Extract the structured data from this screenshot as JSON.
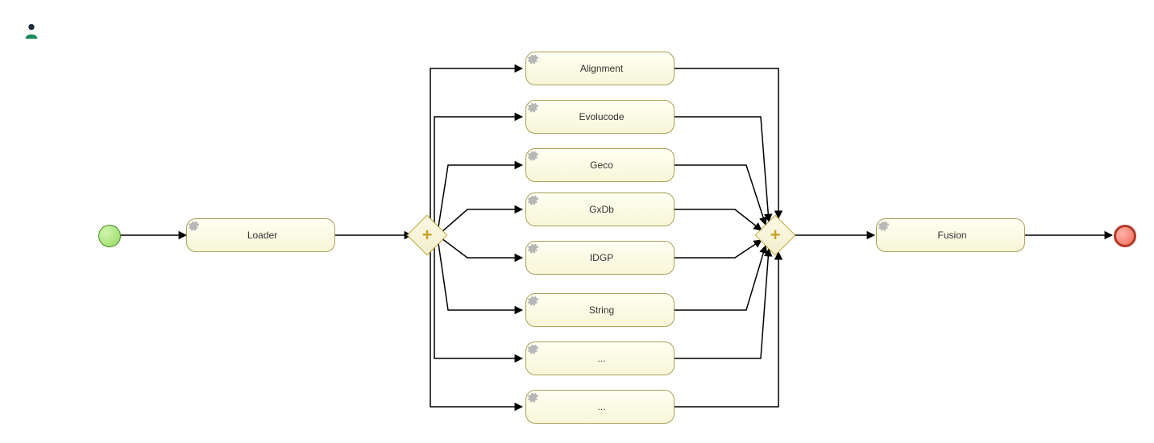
{
  "tasks": {
    "loader": "Loader",
    "alignment": "Alignment",
    "evolucode": "Evolucode",
    "geco": "Geco",
    "gxdb": "GxDb",
    "idgp": "IDGP",
    "string": "String",
    "placeholder1": "...",
    "placeholder2": "...",
    "fusion": "Fusion"
  },
  "icons": {
    "actor": "actor-icon",
    "gear": "gear-icon",
    "gateway_plus": "+"
  },
  "events": {
    "start": "start",
    "end": "end"
  }
}
